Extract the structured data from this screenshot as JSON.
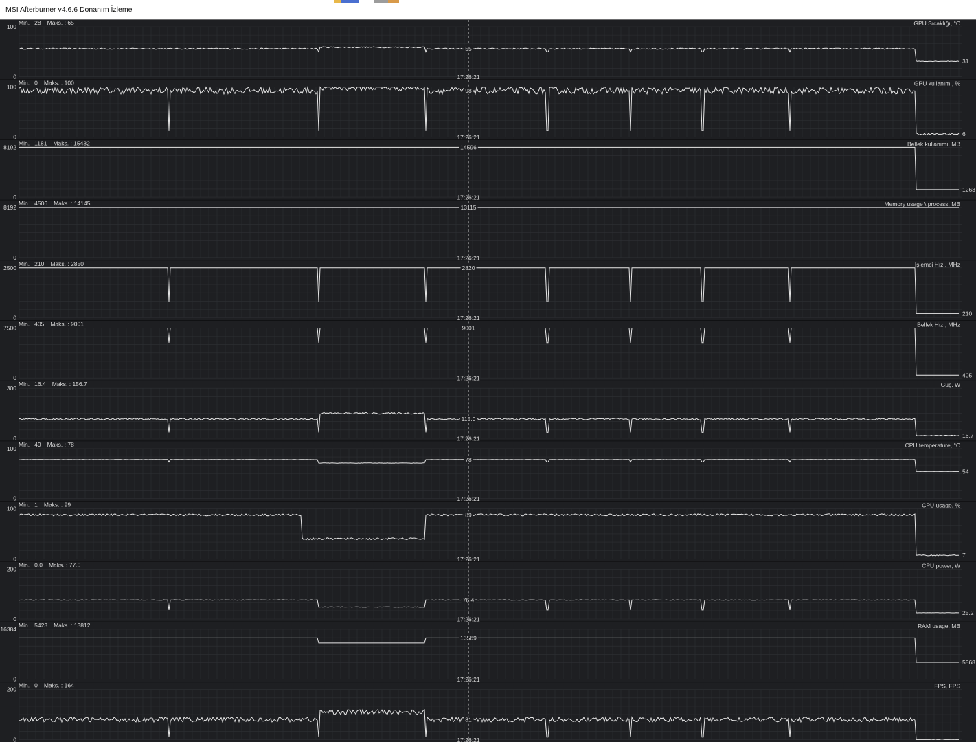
{
  "window": {
    "title": "MSI Afterburner v4.6.6 Donanım İzleme"
  },
  "cursor_time": "17:26:21",
  "graphs": [
    {
      "name": "GPU Sıcaklığı, °C",
      "min_label": "Min. : 28",
      "max_label": "Maks. : 65",
      "scale_max": "100",
      "scale_min": "0",
      "ymax": 100,
      "cursor_value": "55",
      "current_value": "31",
      "baseline": 56,
      "noise": 1.2,
      "spike_every": 0,
      "spike_depth": 0,
      "end_value": 31,
      "mid_block": [
        464,
        620,
        59
      ],
      "dip_positions": [
        464,
        620,
        797,
        918,
        1023,
        1150
      ],
      "dip_depth": 6
    },
    {
      "name": "GPU kullanımı, %",
      "min_label": "Min. : 0",
      "max_label": "Maks. : 100",
      "scale_max": "100",
      "scale_min": "0",
      "ymax": 100,
      "cursor_value": "98",
      "current_value": "6",
      "baseline": 93,
      "noise": 7,
      "spike_every": 0,
      "spike_depth": 0,
      "end_value": 6,
      "mid_block": [
        464,
        620,
        99
      ],
      "dip_positions": [
        246,
        464,
        620,
        797,
        918,
        1023,
        1150
      ],
      "dip_depth": 80
    },
    {
      "name": "Bellek kullanımı, MB",
      "min_label": "Min. : 1181",
      "max_label": "Maks. : 15432",
      "scale_max": "8192",
      "scale_min": "0",
      "ymax": 8192,
      "cursor_value": "14596",
      "current_value": "1263",
      "baseline": 8192,
      "noise": 0,
      "spike_every": 0,
      "spike_depth": 0,
      "end_value": 1263,
      "mid_block": null,
      "dip_positions": [],
      "dip_depth": 0
    },
    {
      "name": "Memory usage \\ process, MB",
      "min_label": "Min. : 4506",
      "max_label": "Maks. : 14145",
      "scale_max": "8192",
      "scale_min": "0",
      "ymax": 8192,
      "cursor_value": "13115",
      "current_value": "",
      "baseline": 8192,
      "noise": 0,
      "spike_every": 0,
      "spike_depth": 0,
      "end_value": 8192,
      "mid_block": null,
      "dip_positions": [],
      "dip_depth": 0
    },
    {
      "name": "İşlemci Hızı, MHz",
      "min_label": "Min. : 210",
      "max_label": "Maks. : 2850",
      "scale_max": "2500",
      "scale_min": "0",
      "ymax": 2500,
      "cursor_value": "2820",
      "current_value": "210",
      "baseline": 2500,
      "noise": 0,
      "spike_every": 0,
      "spike_depth": 0,
      "end_value": 210,
      "mid_block": null,
      "dip_positions": [
        246,
        464,
        620,
        797,
        918,
        1023,
        1150
      ],
      "dip_depth": 1700
    },
    {
      "name": "Bellek Hızı, MHz",
      "min_label": "Min. : 405",
      "max_label": "Maks. : 9001",
      "scale_max": "7500",
      "scale_min": "0",
      "ymax": 7500,
      "cursor_value": "9001",
      "current_value": "405",
      "baseline": 7500,
      "noise": 0,
      "spike_every": 0,
      "spike_depth": 0,
      "end_value": 405,
      "mid_block": null,
      "dip_positions": [
        246,
        464,
        620,
        797,
        918,
        1023,
        1150
      ],
      "dip_depth": 2200
    },
    {
      "name": "Güç, W",
      "min_label": "Min. : 16.4",
      "max_label": "Maks. : 156.7",
      "scale_max": "300",
      "scale_min": "0",
      "ymax": 300,
      "cursor_value": "115.0",
      "current_value": "16.7",
      "baseline": 115,
      "noise": 5,
      "spike_every": 0,
      "spike_depth": 0,
      "end_value": 16.7,
      "mid_block": [
        464,
        620,
        150
      ],
      "dip_positions": [
        246,
        464,
        620,
        797,
        918,
        1023,
        1150
      ],
      "dip_depth": 80
    },
    {
      "name": "CPU temperature, °C",
      "min_label": "Min. : 49",
      "max_label": "Maks. : 78",
      "scale_max": "100",
      "scale_min": "0",
      "ymax": 100,
      "cursor_value": "78",
      "current_value": "54",
      "baseline": 78,
      "noise": 0.3,
      "spike_every": 0,
      "spike_depth": 0,
      "end_value": 54,
      "mid_block": [
        464,
        620,
        71
      ],
      "dip_positions": [
        246,
        797,
        918,
        1023,
        1150
      ],
      "dip_depth": 5
    },
    {
      "name": "CPU usage, %",
      "min_label": "Min. : 1",
      "max_label": "Maks. : 99",
      "scale_max": "100",
      "scale_min": "0",
      "ymax": 100,
      "cursor_value": "89",
      "current_value": "7",
      "baseline": 88,
      "noise": 2,
      "spike_every": 0,
      "spike_depth": 0,
      "end_value": 7,
      "mid_block": [
        440,
        620,
        40
      ],
      "dip_positions": [],
      "dip_depth": 0
    },
    {
      "name": "CPU power, W",
      "min_label": "Min. : 0.0",
      "max_label": "Maks. : 77.5",
      "scale_max": "200",
      "scale_min": "0",
      "ymax": 200,
      "cursor_value": "76.4",
      "current_value": "25.2",
      "baseline": 76,
      "noise": 1,
      "spike_every": 0,
      "spike_depth": 0,
      "end_value": 25.2,
      "mid_block": [
        464,
        620,
        48
      ],
      "dip_positions": [
        246,
        797,
        918,
        1023,
        1150
      ],
      "dip_depth": 40
    },
    {
      "name": "RAM usage, MB",
      "min_label": "Min. : 5423",
      "max_label": "Maks. : 13812",
      "scale_max": "16384",
      "scale_min": "0",
      "ymax": 16384,
      "cursor_value": "13569",
      "current_value": "5568",
      "baseline": 13600,
      "noise": 0,
      "spike_every": 0,
      "spike_depth": 0,
      "end_value": 5568,
      "mid_block": [
        464,
        620,
        11900
      ],
      "dip_positions": [],
      "dip_depth": 0
    },
    {
      "name": "FPS, FPS",
      "min_label": "Min. : 0",
      "max_label": "Maks. : 164",
      "scale_max": "200",
      "scale_min": "0",
      "ymax": 200,
      "cursor_value": "81",
      "current_value": "",
      "baseline": 80,
      "noise": 10,
      "spike_every": 0,
      "spike_depth": 0,
      "end_value": 0,
      "mid_block": [
        464,
        620,
        110
      ],
      "dip_positions": [
        246,
        464,
        620,
        797,
        918,
        1023,
        1150
      ],
      "dip_depth": 70
    }
  ],
  "colors": {
    "background": "#1e1f22",
    "grid": "#2e3034",
    "line": "#e8e8e8",
    "text": "#d8d8d8",
    "cursor": "#c8c8c8"
  }
}
